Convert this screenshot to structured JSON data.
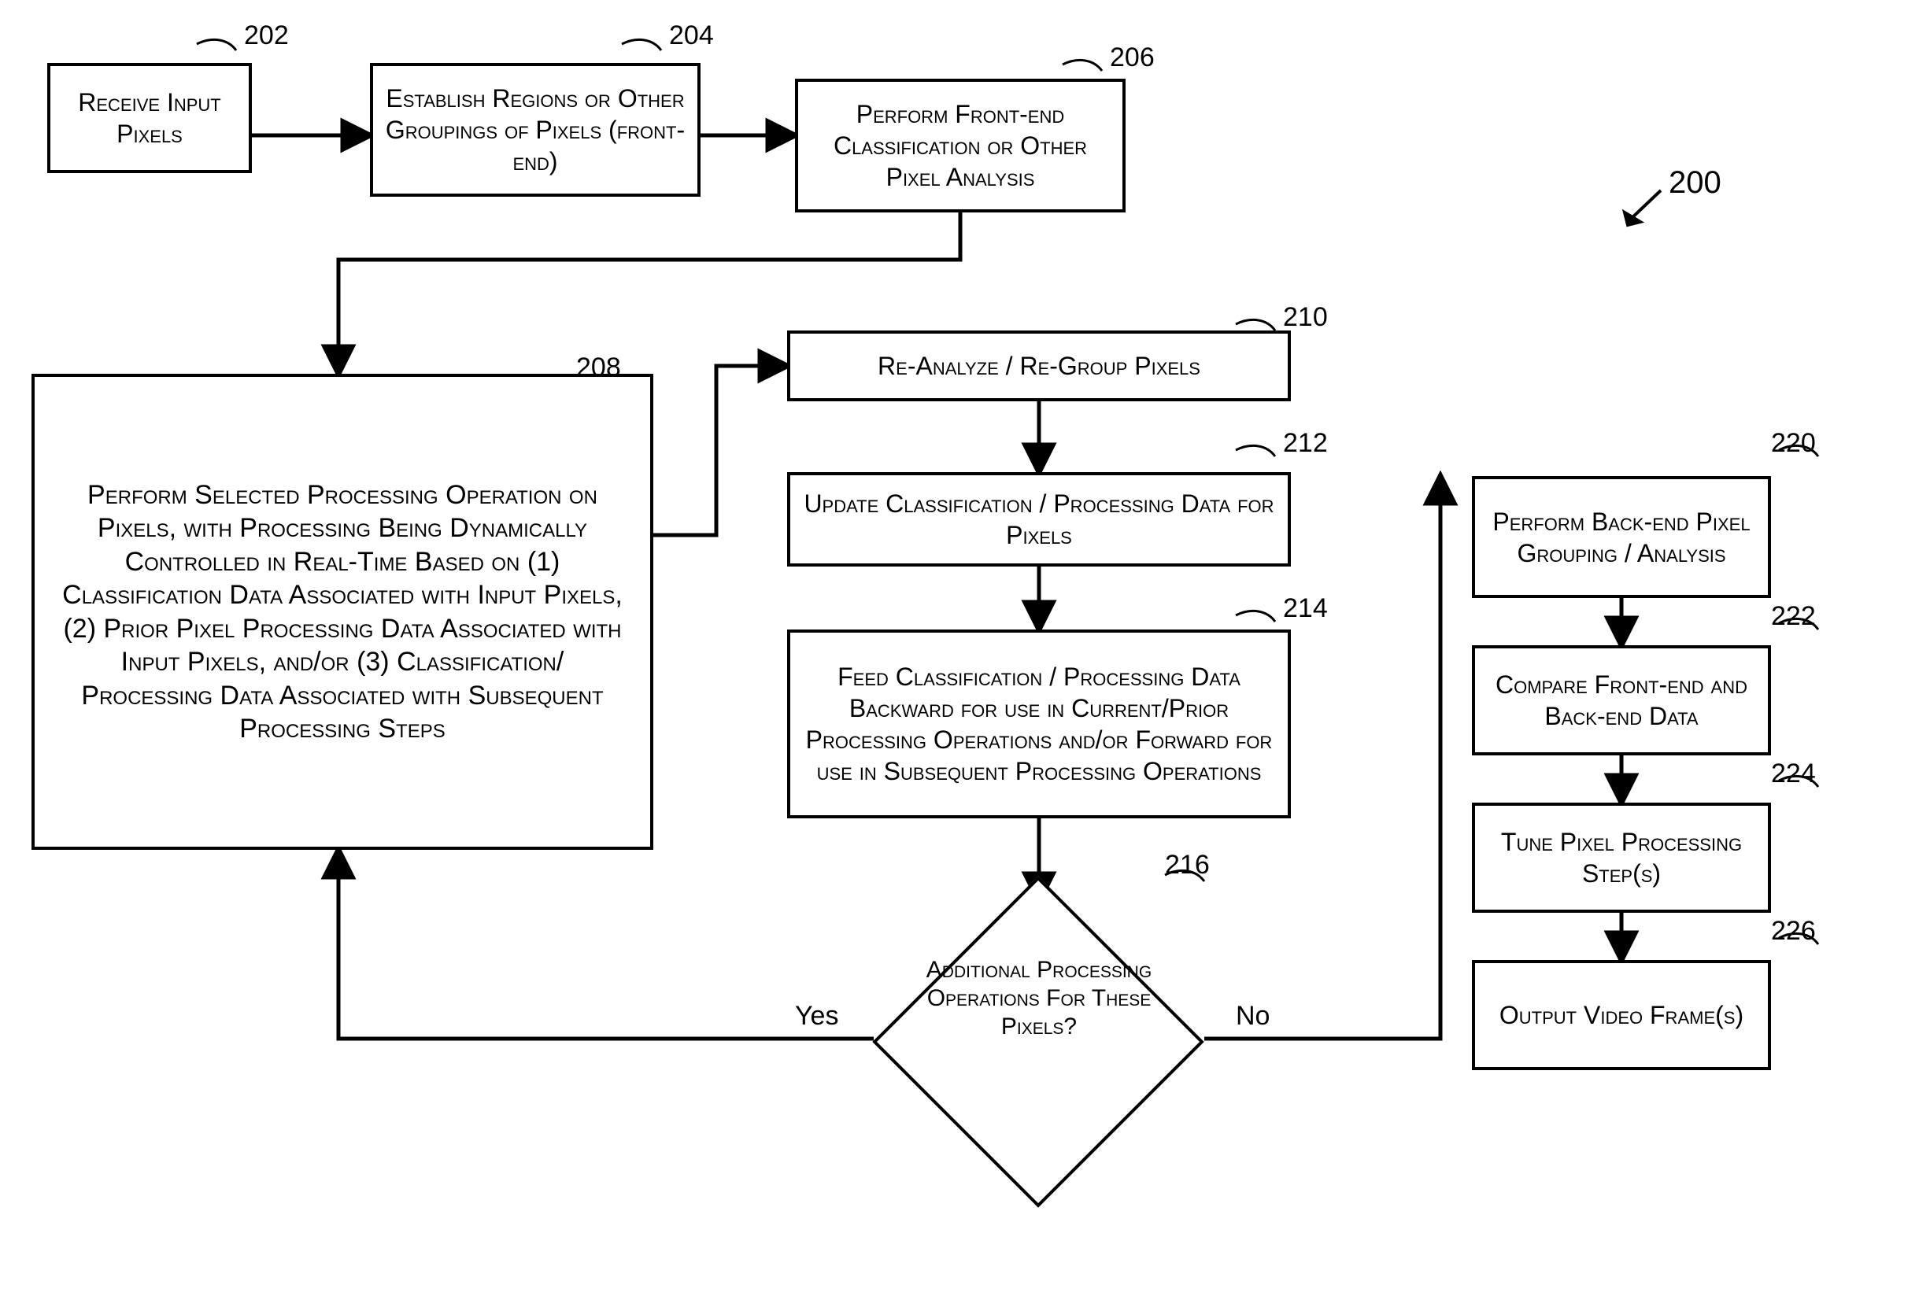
{
  "figure_ref": "200",
  "nodes": {
    "n202": {
      "ref": "202",
      "text": "Receive Input Pixels"
    },
    "n204": {
      "ref": "204",
      "text": "Establish Regions or Other Groupings of Pixels (front-end)"
    },
    "n206": {
      "ref": "206",
      "text": "Perform Front-end Classification or Other Pixel Analysis"
    },
    "n208": {
      "ref": "208",
      "text": "Perform Selected Processing Operation on Pixels, with Processing Being Dynamically Controlled in Real-Time Based on (1) Classification Data Associated with Input Pixels, (2) Prior Pixel Processing Data Associated with Input Pixels, and/or (3) Classification/ Processing Data Associated with Subsequent Processing Steps"
    },
    "n210": {
      "ref": "210",
      "text": "Re-Analyze / Re-Group Pixels"
    },
    "n212": {
      "ref": "212",
      "text": "Update Classification / Processing Data for Pixels"
    },
    "n214": {
      "ref": "214",
      "text": "Feed Classification / Processing Data Backward for use in Current/Prior Processing Operations and/or Forward for use in Subsequent Processing Operations"
    },
    "n216": {
      "ref": "216",
      "text": "Additional Processing Operations For These Pixels?"
    },
    "n220": {
      "ref": "220",
      "text": "Perform Back-end Pixel Grouping / Analysis"
    },
    "n222": {
      "ref": "222",
      "text": "Compare Front-end and Back-end Data"
    },
    "n224": {
      "ref": "224",
      "text": "Tune Pixel Processing Step(s)"
    },
    "n226": {
      "ref": "226",
      "text": "Output Video Frame(s)"
    }
  },
  "edges": {
    "yes_label": "Yes",
    "no_label": "No"
  }
}
